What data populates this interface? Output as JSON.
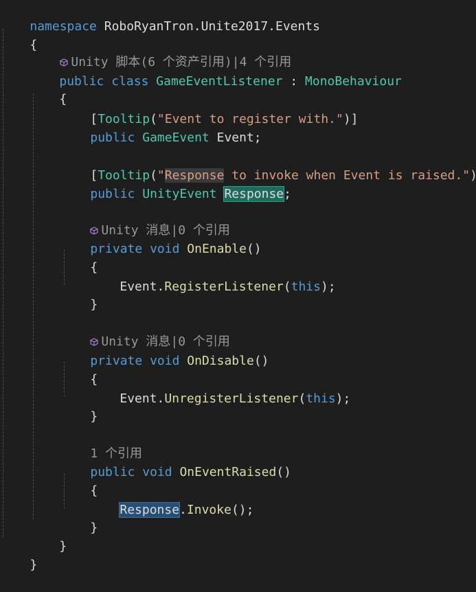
{
  "editor": {
    "lines": {
      "ns_kw": "namespace",
      "ns_name": " RoboRyanTron.Unite2017.Events",
      "open_brace": "{",
      "lens_class": "Unity 脚本(6 个资产引用)|4 个引用",
      "class_public": "public",
      "class_kw": "class",
      "class_name": "GameEventListener",
      "class_colon": " : ",
      "class_base": "MonoBehaviour",
      "tooltip1_open": "[",
      "tooltip1_attr": "Tooltip",
      "tooltip1_paren": "(",
      "tooltip1_str": "\"Event to register with.\"",
      "tooltip1_close": ")]",
      "field1_public": "public",
      "field1_type": "GameEvent",
      "field1_name": " Event;",
      "tooltip2_open": "[",
      "tooltip2_attr": "Tooltip",
      "tooltip2_paren": "(",
      "tooltip2_str_a": "\"",
      "tooltip2_str_hl": "Response",
      "tooltip2_str_b": " to invoke when Event is raised.\"",
      "tooltip2_close": ")]",
      "field2_public": "public",
      "field2_type": "UnityEvent",
      "field2_name": "Response",
      "field2_semi": ";",
      "lens_enable": "Unity 消息|0 个引用",
      "enable_private": "private",
      "enable_void": "void",
      "enable_name": "OnEnable",
      "enable_parens": "()",
      "enable_open": "{",
      "enable_obj": "Event.",
      "enable_call": "RegisterListener",
      "enable_paren_open": "(",
      "enable_this": "this",
      "enable_paren_close": ");",
      "enable_close": "}",
      "lens_disable": "Unity 消息|0 个引用",
      "disable_private": "private",
      "disable_void": "void",
      "disable_name": "OnDisable",
      "disable_parens": "()",
      "disable_open": "{",
      "disable_obj": "Event.",
      "disable_call": "UnregisterListener",
      "disable_paren_open": "(",
      "disable_this": "this",
      "disable_paren_close": ");",
      "disable_close": "}",
      "lens_raised": "1 个引用",
      "raised_public": "public",
      "raised_void": "void",
      "raised_name": "OnEventRaised",
      "raised_parens": "()",
      "raised_open": "{",
      "raised_obj": "Response",
      "raised_dot": ".",
      "raised_call": "Invoke",
      "raised_end": "();",
      "raised_close": "}",
      "class_close": "}",
      "ns_close": "}"
    },
    "colors": {
      "background": "#1e1e1e",
      "keyword": "#569cd6",
      "type": "#4ec9b0",
      "string": "#d69d85",
      "method": "#dcdcaa",
      "text": "#dcdcdc",
      "codelens": "#999999"
    },
    "icons": {
      "unity_script": "cube-icon"
    }
  }
}
